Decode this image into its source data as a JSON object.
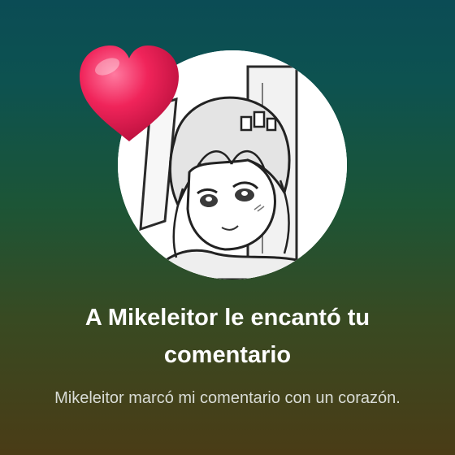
{
  "notification": {
    "title": "A Mikeleitor le encantó tu comentario",
    "body": "Mikeleitor marcó mi comentario con un corazón."
  },
  "icons": {
    "reaction": "heart-icon",
    "avatar": "user-avatar"
  },
  "colors": {
    "background_top": "#0b4c55",
    "background_bottom": "#4a3c16",
    "heart": "#f0245a",
    "title_text": "#ffffff",
    "body_text": "#d9dcd6"
  }
}
